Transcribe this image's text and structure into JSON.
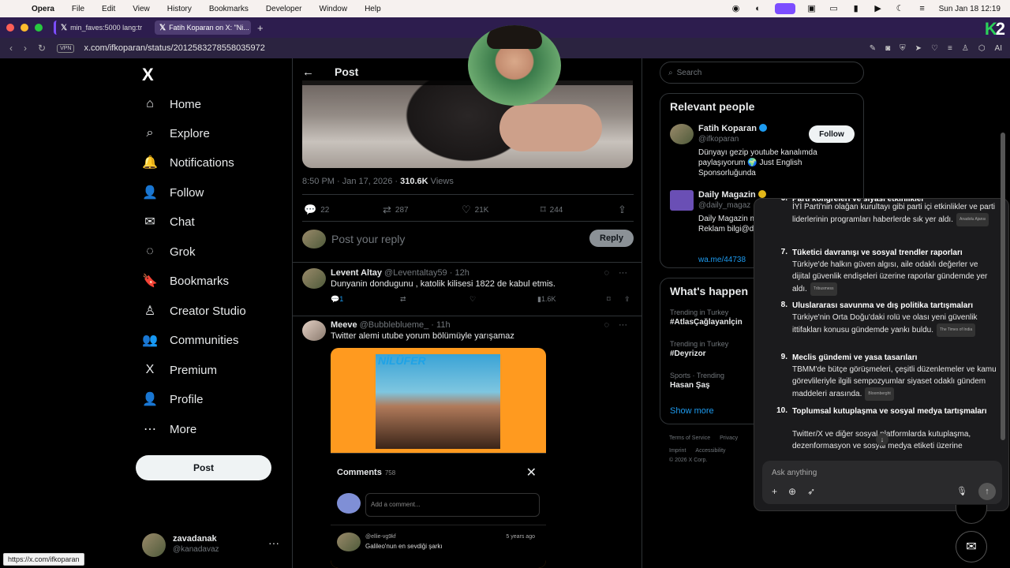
{
  "menubar": {
    "app": "Opera",
    "items": [
      "File",
      "Edit",
      "View",
      "History",
      "Bookmarks",
      "Developer",
      "Window",
      "Help"
    ],
    "clock": "Sun Jan 18  12:19"
  },
  "tabs": [
    {
      "label": "min_faves:5000 lang:tr"
    },
    {
      "label": "Fatih Koparan on X: \"Ni..."
    }
  ],
  "address": {
    "vpn": "VPN",
    "url": "x.com/ifkoparan/status/2012583278558035972",
    "ai": "AI"
  },
  "brand_corner": {
    "k": "K",
    "n": "2"
  },
  "nav": {
    "logo": "X",
    "items": [
      {
        "label": "Home",
        "icon": "⌂"
      },
      {
        "label": "Explore",
        "icon": "⌕"
      },
      {
        "label": "Notifications",
        "icon": "🔔"
      },
      {
        "label": "Follow",
        "icon": "👤"
      },
      {
        "label": "Chat",
        "icon": "✉"
      },
      {
        "label": "Grok",
        "icon": "◌"
      },
      {
        "label": "Bookmarks",
        "icon": "🔖"
      },
      {
        "label": "Creator Studio",
        "icon": "♙"
      },
      {
        "label": "Communities",
        "icon": "👥"
      },
      {
        "label": "Premium",
        "icon": "X"
      },
      {
        "label": "Profile",
        "icon": "👤"
      },
      {
        "label": "More",
        "icon": "⋯"
      }
    ],
    "post_button": "Post",
    "account": {
      "name": "zavadanak",
      "handle": "@kanadavaz",
      "more": "···"
    }
  },
  "post": {
    "header_title": "Post",
    "back": "←",
    "meta_time": "8:50 PM · Jan 17, 2026 · ",
    "views_count": "310.6K",
    "views_label": " Views",
    "actions": {
      "replies": "22",
      "reposts": "287",
      "likes": "21K",
      "bookmarks": "244"
    },
    "reply_placeholder": "Post your reply",
    "reply_button": "Reply"
  },
  "replies": [
    {
      "name": "Levent Altay",
      "handle": "@Leventaltay59 · 12h",
      "text": "Dunyanin dondugunu , katolik kilisesi 1822 de kabul etmis.",
      "reply_count": "1",
      "views": "1.6K"
    },
    {
      "name": "Meeve",
      "handle": "@Bubbleblueme_ · 11h",
      "text": "Twitter alemi utube yorum bölümüyle yarışamaz"
    }
  ],
  "media": {
    "brand": "NİLÜFER",
    "comments_title": "Comments",
    "comments_count": "758",
    "add_comment_placeholder": "Add a comment...",
    "comment_user": "@ellie-vg9kf",
    "comment_time": "5 years ago",
    "comment_text": "Galileo'nun en sevdiği şarkı"
  },
  "right": {
    "search_placeholder": "Search",
    "relevant_title": "Relevant people",
    "people": [
      {
        "name": "Fatih Koparan",
        "handle": "@ifkoparan",
        "bio": "Dünyayı gezip youtube kanalımda paylaşıyorum 🌍 Just English Sponsorluğunda",
        "follow": "Follow"
      },
      {
        "name": "Daily Magazin",
        "handle": "@daily_magaz",
        "bio": "Daily Magazin magazin düny atıyor Reklam bilgi@dailymag",
        "link": "wa.me/44738"
      }
    ],
    "happening_title": "What's happen",
    "trends": [
      {
        "context": "Trending in Turkey",
        "name": "#AtlasÇağlayanİçin"
      },
      {
        "context": "Trending in Turkey",
        "name": "#Deyrizor"
      },
      {
        "context": "Sports · Trending",
        "name": "Hasan Şaş"
      }
    ],
    "show_more": "Show more",
    "footer": [
      "Terms of Service",
      "Privacy",
      "Imprint",
      "Accessibility"
    ],
    "copyright": "© 2026 X Corp."
  },
  "ai_panel": {
    "items": [
      {
        "num": "6.",
        "title": "Parti kongreleri ve siyasi etkinlikler",
        "body": "İYİ Parti'nin olağan kurultayı gibi parti içi etkinlikler ve parti liderlerinin programları haberlerde sık yer aldı.",
        "source": "Anadolu Ajansı"
      },
      {
        "num": "7.",
        "title": "Tüketici davranışı ve sosyal trendler raporları",
        "body": "Türkiye'de halkın güven algısı, aile odaklı değerler ve dijital güvenlik endişeleri üzerine raporlar gündemde yer aldı.",
        "source": "Tribusmess"
      },
      {
        "num": "8.",
        "title": "Uluslararası savunma ve dış politika tartışmaları",
        "body": "Türkiye'nin Orta Doğu'daki rolü ve olası yeni güvenlik ittifakları konusu gündemde yankı buldu.",
        "source": "The Times of India"
      },
      {
        "num": "9.",
        "title": "Meclis gündemi ve yasa tasarıları",
        "body": "TBMM'de bütçe görüşmeleri, çeşitli düzenlemeler ve kamu görevlileriyle ilgili sempozyumlar siyaset odaklı gündem maddeleri arasında.",
        "source": "Bloomberght"
      },
      {
        "num": "10.",
        "title": "Toplumsal kutuplaşma ve sosyal medya tartışmaları",
        "body": "Twitter/X ve diğer sosyal platformlarda kutuplaşma, dezenformasyon ve sosyal medya etiketi üzerine",
        "source": ""
      }
    ],
    "input_placeholder": "Ask anything"
  },
  "status_url": "https://x.com/ifkoparan"
}
